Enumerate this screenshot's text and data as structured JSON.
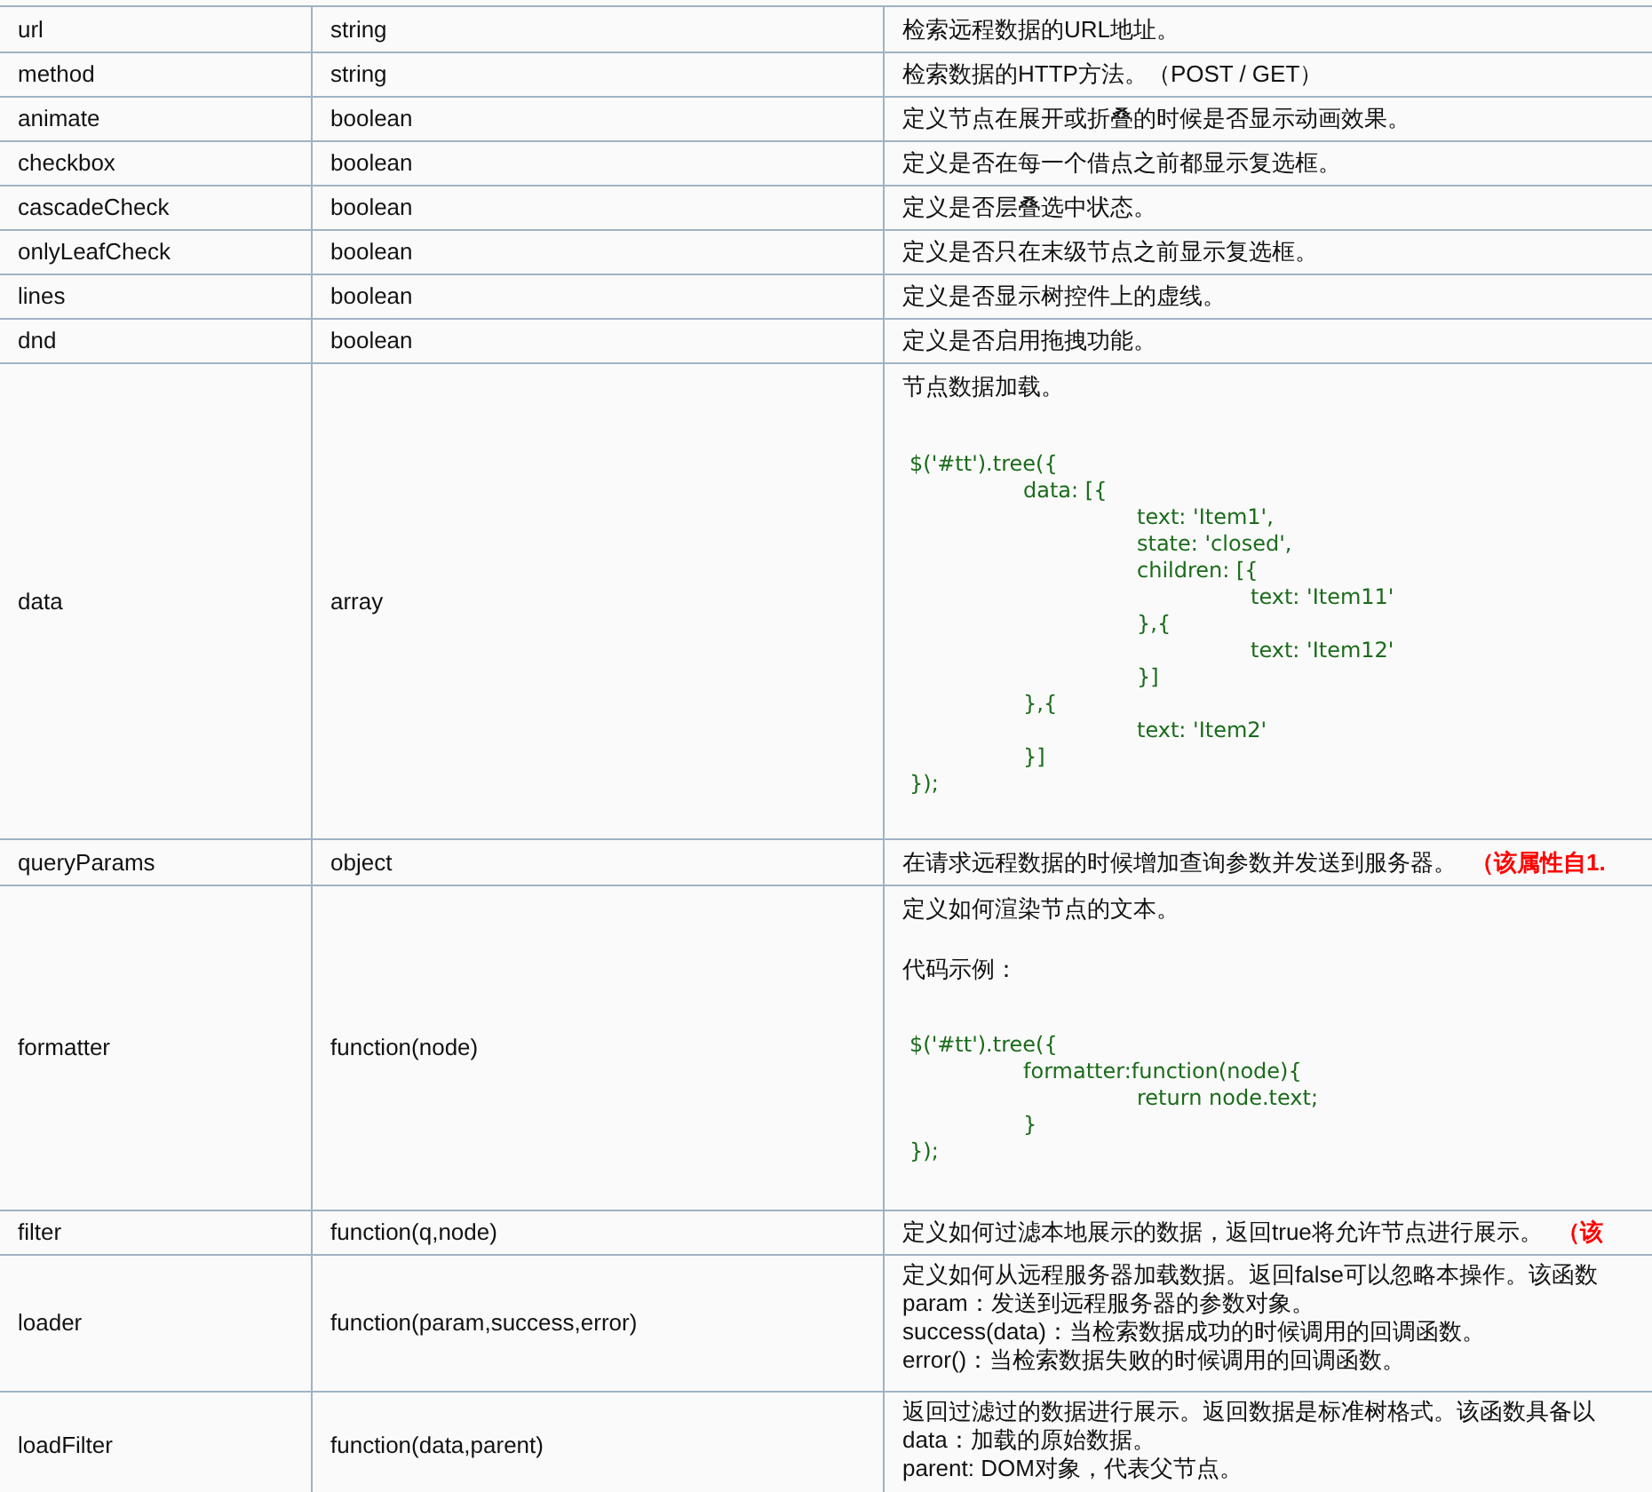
{
  "rows": [
    {
      "name": "url",
      "type": "string",
      "description": [
        {
          "kind": "text",
          "text": "检索远程数据的URL地址。"
        }
      ]
    },
    {
      "name": "method",
      "type": "string",
      "description": [
        {
          "kind": "text",
          "text": "检索数据的HTTP方法。（POST / GET）"
        }
      ]
    },
    {
      "name": "animate",
      "type": "boolean",
      "description": [
        {
          "kind": "text",
          "text": "定义节点在展开或折叠的时候是否显示动画效果。"
        }
      ]
    },
    {
      "name": "checkbox",
      "type": "boolean",
      "description": [
        {
          "kind": "text",
          "text": "定义是否在每一个借点之前都显示复选框。"
        }
      ]
    },
    {
      "name": "cascadeCheck",
      "type": "boolean",
      "description": [
        {
          "kind": "text",
          "text": "定义是否层叠选中状态。"
        }
      ]
    },
    {
      "name": "onlyLeafCheck",
      "type": "boolean",
      "description": [
        {
          "kind": "text",
          "text": "定义是否只在末级节点之前显示复选框。"
        }
      ]
    },
    {
      "name": "lines",
      "type": "boolean",
      "description": [
        {
          "kind": "text",
          "text": "定义是否显示树控件上的虚线。"
        }
      ]
    },
    {
      "name": "dnd",
      "type": "boolean",
      "description": [
        {
          "kind": "text",
          "text": "定义是否启用拖拽功能。"
        }
      ]
    },
    {
      "name": "data",
      "type": "array",
      "description": [
        {
          "kind": "text",
          "text": "节点数据加载。"
        },
        {
          "kind": "code",
          "text": "$('#tt').tree({\n\tdata: [{\n\t\ttext: 'Item1',\n\t\tstate: 'closed',\n\t\tchildren: [{\n\t\t\ttext: 'Item11'\n\t\t},{\n\t\t\ttext: 'Item12'\n\t\t}]\n\t},{\n\t\ttext: 'Item2'\n\t}]\n});"
        }
      ]
    },
    {
      "name": "queryParams",
      "type": "object",
      "description": [
        {
          "kind": "text",
          "text": "在请求远程数据的时候增加查询参数并发送到服务器。",
          "note": "（该属性自1."
        }
      ]
    },
    {
      "name": "formatter",
      "type": "function(node)",
      "description": [
        {
          "kind": "text",
          "text": "定义如何渲染节点的文本。"
        },
        {
          "kind": "text",
          "text": "代码示例："
        },
        {
          "kind": "code",
          "text": "$('#tt').tree({\n\tformatter:function(node){\n\t\treturn node.text;\n\t}\n});"
        }
      ]
    },
    {
      "name": "filter",
      "type": "function(q,node)",
      "description": [
        {
          "kind": "text",
          "text": "定义如何过滤本地展示的数据，返回true将允许节点进行展示。",
          "note": "（该"
        }
      ]
    },
    {
      "name": "loader",
      "type": "function(param,success,error)",
      "description": [
        {
          "kind": "line",
          "text": "定义如何从远程服务器加载数据。返回false可以忽略本操作。该函数"
        },
        {
          "kind": "line",
          "text": "param：发送到远程服务器的参数对象。"
        },
        {
          "kind": "line",
          "text": "success(data)：当检索数据成功的时候调用的回调函数。"
        },
        {
          "kind": "line",
          "text": "error()：当检索数据失败的时候调用的回调函数。"
        }
      ]
    },
    {
      "name": "loadFilter",
      "type": "function(data,parent)",
      "description": [
        {
          "kind": "line",
          "text": "返回过滤过的数据进行展示。返回数据是标准树格式。该函数具备以"
        },
        {
          "kind": "line",
          "text": "data：加载的原始数据。"
        },
        {
          "kind": "line",
          "text": "parent: DOM对象，代表父节点。"
        }
      ]
    }
  ]
}
